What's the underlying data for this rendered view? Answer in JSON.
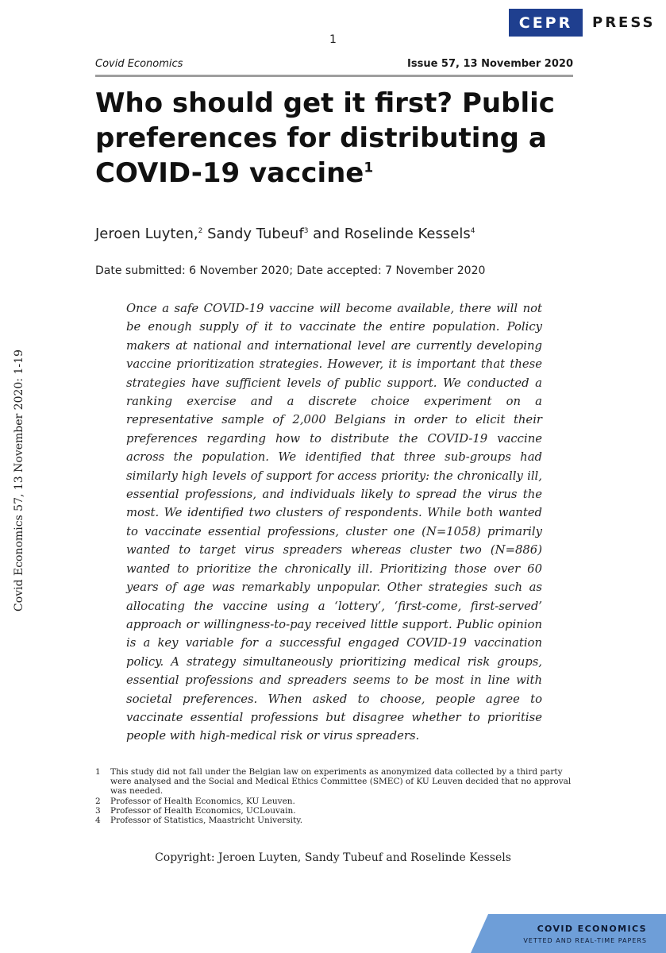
{
  "logo": {
    "primary": "CEPR",
    "secondary": "PRESS"
  },
  "page_number": "1",
  "running_head": {
    "journal": "Covid Economics",
    "issue": "Issue 57, 13 November 2020"
  },
  "title": {
    "text": "Who should get it first? Public preferences for distributing a COVID-19 vaccine",
    "footnote_mark": "1"
  },
  "authors": [
    {
      "name": "Jeroen Luyten,",
      "mark": "2"
    },
    {
      "name": " Sandy Tubeuf",
      "mark": "3"
    },
    {
      "name": " and Roselinde Kessels",
      "mark": "4"
    }
  ],
  "dates": "Date submitted: 6 November 2020; Date accepted: 7 November 2020",
  "abstract": "Once a safe COVID-19 vaccine will become available, there will not be enough supply of it to vaccinate the entire population. Policy makers at national and international level are currently developing vaccine prioritization strategies. However, it is important that these strategies have sufficient levels of public support. We conducted a ranking exercise and a discrete choice experiment on a representative sample of 2,000 Belgians in order to elicit their preferences regarding how to distribute the COVID-19 vaccine across the population. We identified that three sub-groups had similarly high levels of support for access priority: the chronically ill, essential professions, and individuals likely to spread the virus the most. We identified two clusters of respondents. While both wanted to vaccinate essential professions, cluster one (N=1058) primarily wanted to target virus spreaders whereas cluster two (N=886) wanted to prioritize the chronically ill. Prioritizing those over 60 years of age was remarkably unpopular. Other strategies such as allocating the vaccine using a ‘lottery’, ‘first-come, first-served’ approach or willingness-to-pay received little support. Public opinion is a key variable for a successful engaged COVID-19 vaccination policy. A strategy simultaneously prioritizing medical risk groups, essential professions and spreaders seems to be most in line with societal preferences. When asked to choose, people agree to vaccinate essential professions but disagree whether to prioritise people with high-medical risk or virus spreaders.",
  "side_citation": "Covid Economics 57, 13 November 2020: 1-19",
  "footnotes": [
    {
      "num": "1",
      "text": "This study did not fall under the Belgian law on experiments as anonymized data collected by a third party were analysed and the Social and Medical Ethics Committee (SMEC) of KU Leuven decided that no approval was needed."
    },
    {
      "num": "2",
      "text": "Professor of Health Economics, KU Leuven."
    },
    {
      "num": "3",
      "text": "Professor of Health Economics, UCLouvain."
    },
    {
      "num": "4",
      "text": "Professor of Statistics, Maastricht University."
    }
  ],
  "copyright": "Copyright: Jeroen Luyten, Sandy Tubeuf and Roselinde Kessels",
  "banner": {
    "line1": "COVID ECONOMICS",
    "line2": "VETTED AND REAL-TIME PAPERS"
  },
  "colors": {
    "logo_blue": "#1f3f8f",
    "banner_blue": "#6e9ed8",
    "rule_gray": "#9e9e9e"
  }
}
